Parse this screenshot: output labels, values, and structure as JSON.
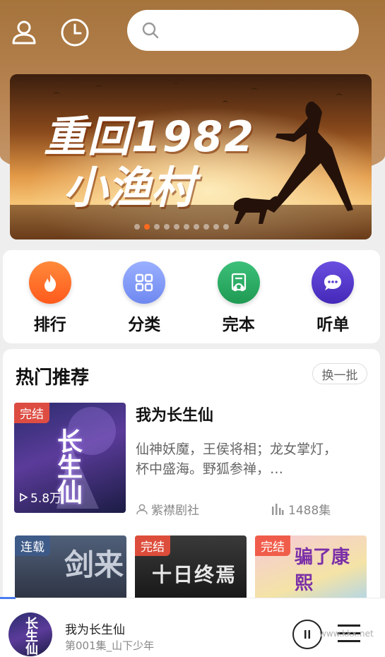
{
  "search": {
    "placeholder": ""
  },
  "banner": {
    "line1": "重回1982",
    "line2": "小渔村",
    "slide_count": 10,
    "active_slide": 2
  },
  "quick_nav": [
    {
      "label": "排行",
      "icon": "flame-icon",
      "color": "#ff6a25"
    },
    {
      "label": "分类",
      "icon": "grid-icon",
      "color": "#7e97f5"
    },
    {
      "label": "完本",
      "icon": "book-headphones-icon",
      "color": "#2aa861"
    },
    {
      "label": "听单",
      "icon": "chat-bubble-icon",
      "color": "#5a3fcf"
    }
  ],
  "recommend": {
    "title": "热门推荐",
    "refresh_label": "换一批",
    "featured": {
      "tag": "完结",
      "cover_text": "长生仙",
      "plays": "5.8万",
      "title": "我为长生仙",
      "description": "仙神妖魔，王侯将相；龙女掌灯，杯中盛海。野狐参禅，…",
      "author": "紫襟剧社",
      "episodes": "1488集"
    },
    "grid": [
      {
        "tag": "连载",
        "cover_text": "剑来"
      },
      {
        "tag": "完结",
        "cover_text": "十日终焉"
      },
      {
        "tag": "完结",
        "cover_text": "骗了康熙"
      }
    ]
  },
  "player": {
    "title": "我为长生仙",
    "subtitle": "第001集_山下少年",
    "cover_text": "长生仙"
  },
  "watermark": "www.kkx.net"
}
